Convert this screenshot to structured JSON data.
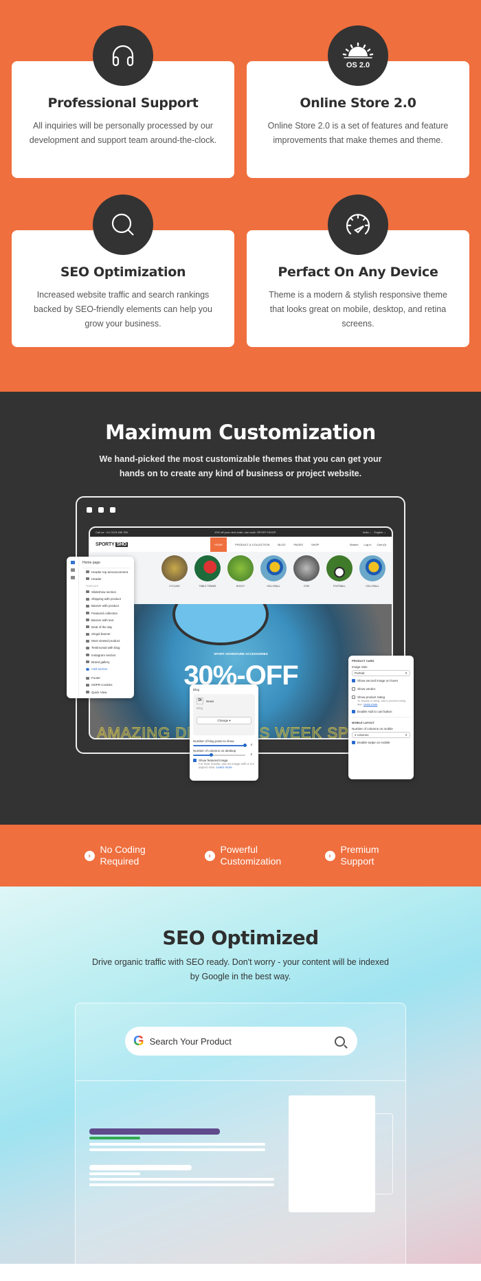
{
  "features": [
    {
      "icon": "headphones-icon",
      "title": "Professional Support",
      "text": "All inquiries will be personally processed by our development and support team around-the-clock."
    },
    {
      "icon": "os-sunrise-icon",
      "badge": "OS 2.0",
      "title": "Online Store 2.0",
      "text": "Online Store 2.0 is a set of features and feature improvements that make themes and theme."
    },
    {
      "icon": "search-icon",
      "title": "SEO Optimization",
      "text": "Increased website traffic and search rankings backed by SEO-friendly elements can help you grow your business."
    },
    {
      "icon": "speedometer-icon",
      "title": "Perfact On Any Device",
      "text": "Theme is a modern & stylish responsive theme that looks great on mobile, desktop, and retina screens."
    }
  ],
  "customization": {
    "title": "Maximum Customization",
    "subtitle": "We hand-picked the most customizable themes that you can get your hands on to create any kind of business or project website.",
    "preview": {
      "topbar": {
        "phone": "Call us: +01 0123 456 789",
        "promo": "10% off your next order, use code: SPORTYSHOP",
        "country": "India ⌄",
        "language": "English ⌄"
      },
      "logo": "SPORTY",
      "logo_box": "SHO",
      "nav": [
        "HOME",
        "PRODUCT & COLLECTION",
        "BLOG",
        "PAGES",
        "SHOP"
      ],
      "nav_right": [
        "Search",
        "Log in",
        "Cart (0)"
      ],
      "categories": [
        "CYCLING",
        "TABLE TENNIS",
        "HOCKY",
        "VOLLYBALL",
        "GYM",
        "FOOTBALL",
        "VOLLYBALL"
      ],
      "hero_tag": "SPORT ADVENTURE ACCESSORIES",
      "hero_title": "30%-OFF",
      "hero_marquee": "AMAZING DEALS THIS WEEK SPORT ACC"
    },
    "sections_panel": {
      "title": "Home page",
      "header_items": [
        "Header top announcement",
        "Header"
      ],
      "template_label": "TEMPLATE",
      "template_items": [
        "Slideshow section",
        "Shipping with product",
        "Banner with product",
        "Featured collection",
        "Banner with text",
        "Deal of the day",
        "Singal banner",
        "Most viewed product",
        "Testimonial with blog",
        "Instagram section",
        "Brand gallery"
      ],
      "add_section": "Add section",
      "footer_items": [
        "Footer",
        "GDPR Cookies",
        "Quick View"
      ]
    },
    "blog_panel": {
      "label": "Blog",
      "blog_name": "News",
      "blog_type": "Blog",
      "change_button": "Change ▾",
      "posts_label": "Number of blog posts to show",
      "posts_value": "4",
      "posts_fraction": 1.0,
      "columns_label": "Number of columns on desktop",
      "columns_value": "2",
      "columns_fraction": 0.35,
      "featured_label": "Show featured image",
      "featured_checked": true,
      "featured_note": "For best results, use an image with a 3:2 aspect ratio.",
      "learn_more": "Learn more"
    },
    "product_panel": {
      "section_title": "PRODUCT CARD",
      "ratio_label": "Image ratio",
      "ratio_value": "Portrait",
      "options": [
        {
          "label": "Show second image on hover",
          "checked": true
        },
        {
          "label": "Show vendor",
          "checked": false
        },
        {
          "label": "Show product rating",
          "checked": false
        }
      ],
      "rating_note": "To display a rating, add a product rating app.",
      "learn_more": "Learn more",
      "add_to_cart": {
        "label": "Enable Add to cart button",
        "checked": true
      },
      "mobile_title": "MOBILE LAYOUT",
      "mobile_cols_label": "Number of columns on mobile",
      "mobile_cols_value": "2 columns",
      "swipe": {
        "label": "Enable swipe on mobile",
        "checked": true
      }
    }
  },
  "benefits": [
    {
      "line1": "No Coding",
      "line2": "Required"
    },
    {
      "line1": "Powerful",
      "line2": "Customization"
    },
    {
      "line1": "Premium",
      "line2": "Support"
    }
  ],
  "seo": {
    "title": "SEO Optimized",
    "subtitle": "Drive organic traffic with SEO ready.  Don't worry - your content will be indexed by Google in the best way.",
    "search_placeholder": "Search Your Product",
    "google_letter": "G"
  },
  "colors": {
    "accent": "#ef6f3e",
    "dark": "#333333",
    "result_title": "#5f4b8b",
    "result_url": "#34a853"
  }
}
